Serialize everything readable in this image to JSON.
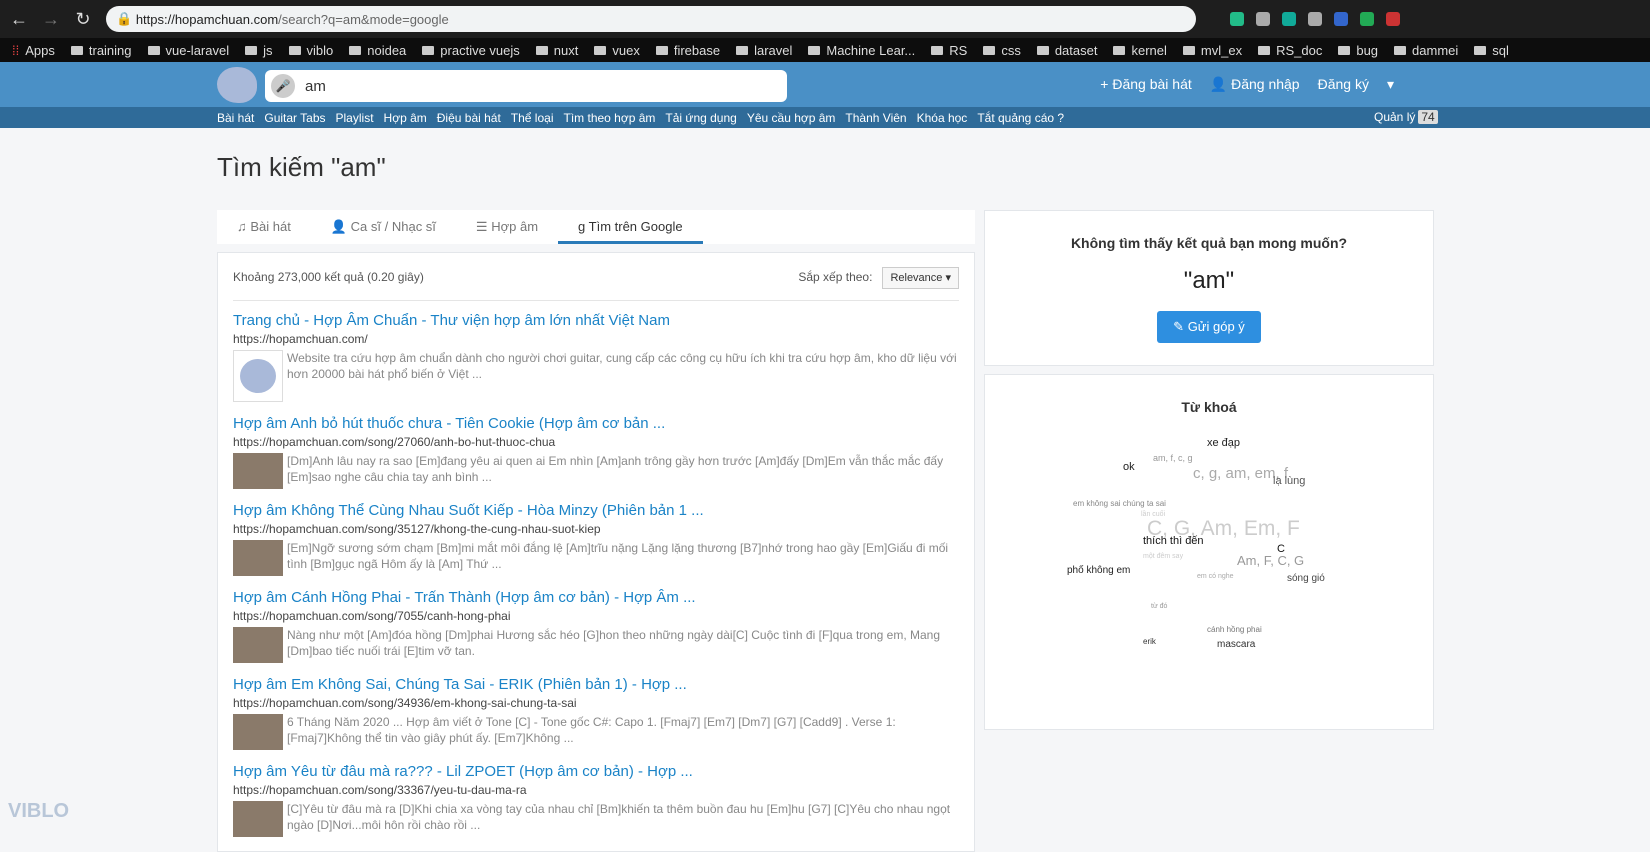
{
  "browser": {
    "url_host": "https://hopamchuan.com",
    "url_path": "/search?q=am&mode=google",
    "bookmarks": [
      "Apps",
      "training",
      "vue-laravel",
      "js",
      "viblo",
      "noidea",
      "practive vuejs",
      "nuxt",
      "vuex",
      "firebase",
      "laravel",
      "Machine Lear...",
      "RS",
      "css",
      "dataset",
      "kernel",
      "mvl_ex",
      "RS_doc",
      "bug",
      "dammei",
      "sql"
    ]
  },
  "header": {
    "search_value": "am",
    "links": [
      "Đăng bài hát",
      "Đăng nhập",
      "Đăng ký"
    ]
  },
  "subnav": {
    "items": [
      "Bài hát",
      "Guitar Tabs",
      "Playlist",
      "Hợp âm",
      "Điệu bài hát",
      "Thể loại",
      "Tìm theo hợp âm",
      "Tải ứng dụng",
      "Yêu cầu hợp âm",
      "Thành Viên",
      "Khóa học",
      "Tắt quảng cáo ?"
    ],
    "manage": "Quản lý",
    "manage_count": "74"
  },
  "page_title": "Tìm kiếm \"am\"",
  "tabs": [
    "Bài hát",
    "Ca sĩ / Nhạc sĩ",
    "Hợp âm",
    "Tìm trên Google"
  ],
  "results_meta": {
    "count": "Khoảng 273,000 kết quả (0.20 giây)",
    "sort_label": "Sắp xếp theo:",
    "sort_value": "Relevance"
  },
  "results": [
    {
      "title": "Trang chủ - Hợp Âm Chuẩn - Thư viện hợp âm lớn nhất Việt Nam",
      "url": "https://hopamchuan.com/",
      "snippet": "Website tra cứu hợp âm chuẩn dành cho người chơi guitar, cung cấp các công cụ hữu ích khi tra cứu hợp âm, kho dữ liệu với hơn 20000 bài hát phổ biến ở Việt  ..."
    },
    {
      "title": "Hợp âm Anh bỏ hút thuốc chưa - Tiên Cookie (Hợp âm cơ bản ...",
      "url": "https://hopamchuan.com/song/27060/anh-bo-hut-thuoc-chua",
      "snippet": "[Dm]Anh lâu nay ra sao [Em]đang yêu ai quen ai Em nhìn [Am]anh trông gầy hơn trước [Am]đấy [Dm]Em vẫn thắc mắc đấy [Em]sao nghe câu chia tay anh bình ..."
    },
    {
      "title": "Hợp âm Không Thể Cùng Nhau Suốt Kiếp - Hòa Minzy (Phiên bản 1 ...",
      "url": "https://hopamchuan.com/song/35127/khong-the-cung-nhau-suot-kiep",
      "snippet": "[Em]Ngỡ sương sớm chạm [Bm]mi mắt môi đắng lệ [Am]trĩu nặng Lặng lặng thương [B7]nhớ trong hao gầy [Em]Giấu đi mối tình [Bm]gục ngã Hôm ấy là [Am] Thứ ..."
    },
    {
      "title": "Hợp âm Cánh Hồng Phai - Trấn Thành (Hợp âm cơ bản) - Hợp Âm ...",
      "url": "https://hopamchuan.com/song/7055/canh-hong-phai",
      "snippet": "Nàng như một [Am]đóa hồng [Dm]phai Hương sắc héo [G]hon theo những ngày dài[C] Cuộc tình đi [F]qua trong em, Mang [Dm]bao tiếc nuối trái [E]tim vỡ tan."
    },
    {
      "title": "Hợp âm Em Không Sai, Chúng Ta Sai - ERIK (Phiên bản 1) - Hợp ...",
      "url": "https://hopamchuan.com/song/34936/em-khong-sai-chung-ta-sai",
      "snippet": "6 Tháng Năm 2020 ... Hợp âm viết ở Tone [C] - Tone gốc C#: Capo 1. [Fmaj7] [Em7] [Dm7] [G7] [Cadd9] . Verse 1: [Fmaj7]Không thể tin vào giây phút ấy. [Em7]Không ..."
    },
    {
      "title": "Hợp âm Yêu từ đâu mà ra??? - Lil ZPOET (Hợp âm cơ bản) - Hợp ...",
      "url": "https://hopamchuan.com/song/33367/yeu-tu-dau-ma-ra",
      "snippet": "[C]Yêu từ đâu mà ra [D]Khi chia xa vòng tay của nhau chỉ [Bm]khiến ta thêm buồn đau hu [Em]hu [G7] [C]Yêu cho nhau ngọt ngào [D]Nơi...môi hôn rồi chào rồi ..."
    }
  ],
  "feedback": {
    "title": "Không tìm thấy kết quả bạn mong muốn?",
    "query": "\"am\"",
    "button": "Gửi góp ý"
  },
  "keywords": {
    "title": "Từ khoá",
    "words": [
      "xe đạp",
      "am, f, c, g",
      "ok",
      "c, g, am, em, f",
      "lạ lùng",
      "em không sai chúng ta sai",
      "lần cuối",
      "C, G, Am, Em, F",
      "thích thì đến",
      "C",
      "một đêm say",
      "Am, F, C, G",
      "phố không em",
      "sóng gió",
      "em có nghe",
      "từ đó",
      "cánh hồng phai",
      "erik",
      "mascara"
    ]
  },
  "watermark": "VIBLO"
}
